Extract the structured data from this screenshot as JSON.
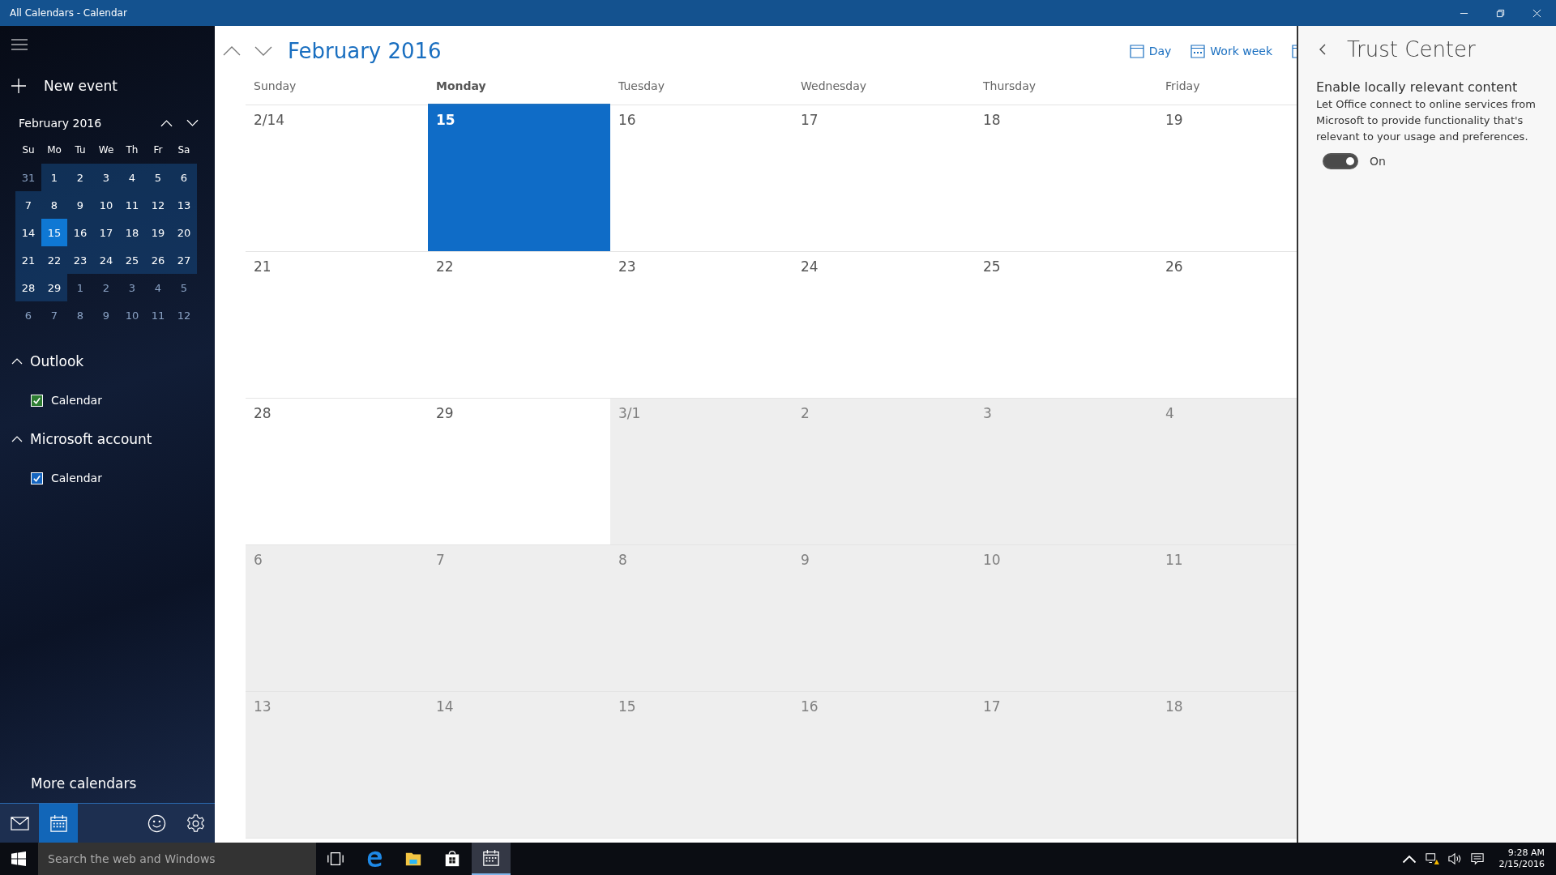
{
  "window": {
    "title": "All Calendars - Calendar"
  },
  "sidebar": {
    "new_event": "New event",
    "mini_calendar": {
      "title": "February 2016",
      "weekdays": [
        "Su",
        "Mo",
        "Tu",
        "We",
        "Th",
        "Fr",
        "Sa"
      ],
      "weeks": [
        [
          {
            "day": "31",
            "in_month": false,
            "today": false
          },
          {
            "day": "1",
            "in_month": true,
            "today": false
          },
          {
            "day": "2",
            "in_month": true,
            "today": false
          },
          {
            "day": "3",
            "in_month": true,
            "today": false
          },
          {
            "day": "4",
            "in_month": true,
            "today": false
          },
          {
            "day": "5",
            "in_month": true,
            "today": false
          },
          {
            "day": "6",
            "in_month": true,
            "today": false
          }
        ],
        [
          {
            "day": "7",
            "in_month": true,
            "today": false
          },
          {
            "day": "8",
            "in_month": true,
            "today": false
          },
          {
            "day": "9",
            "in_month": true,
            "today": false
          },
          {
            "day": "10",
            "in_month": true,
            "today": false
          },
          {
            "day": "11",
            "in_month": true,
            "today": false
          },
          {
            "day": "12",
            "in_month": true,
            "today": false
          },
          {
            "day": "13",
            "in_month": true,
            "today": false
          }
        ],
        [
          {
            "day": "14",
            "in_month": true,
            "today": false
          },
          {
            "day": "15",
            "in_month": true,
            "today": true
          },
          {
            "day": "16",
            "in_month": true,
            "today": false
          },
          {
            "day": "17",
            "in_month": true,
            "today": false
          },
          {
            "day": "18",
            "in_month": true,
            "today": false
          },
          {
            "day": "19",
            "in_month": true,
            "today": false
          },
          {
            "day": "20",
            "in_month": true,
            "today": false
          }
        ],
        [
          {
            "day": "21",
            "in_month": true,
            "today": false
          },
          {
            "day": "22",
            "in_month": true,
            "today": false
          },
          {
            "day": "23",
            "in_month": true,
            "today": false
          },
          {
            "day": "24",
            "in_month": true,
            "today": false
          },
          {
            "day": "25",
            "in_month": true,
            "today": false
          },
          {
            "day": "26",
            "in_month": true,
            "today": false
          },
          {
            "day": "27",
            "in_month": true,
            "today": false
          }
        ],
        [
          {
            "day": "28",
            "in_month": true,
            "today": false
          },
          {
            "day": "29",
            "in_month": true,
            "today": false
          },
          {
            "day": "1",
            "in_month": false,
            "today": false
          },
          {
            "day": "2",
            "in_month": false,
            "today": false
          },
          {
            "day": "3",
            "in_month": false,
            "today": false
          },
          {
            "day": "4",
            "in_month": false,
            "today": false
          },
          {
            "day": "5",
            "in_month": false,
            "today": false
          }
        ],
        [
          {
            "day": "6",
            "in_month": false,
            "today": false
          },
          {
            "day": "7",
            "in_month": false,
            "today": false
          },
          {
            "day": "8",
            "in_month": false,
            "today": false
          },
          {
            "day": "9",
            "in_month": false,
            "today": false
          },
          {
            "day": "10",
            "in_month": false,
            "today": false
          },
          {
            "day": "11",
            "in_month": false,
            "today": false
          },
          {
            "day": "12",
            "in_month": false,
            "today": false
          }
        ]
      ]
    },
    "groups": [
      {
        "name": "Outlook",
        "expanded": true,
        "calendars": [
          {
            "name": "Calendar",
            "checked": true,
            "color": "#2e7d32"
          }
        ]
      },
      {
        "name": "Microsoft account",
        "expanded": true,
        "calendars": [
          {
            "name": "Calendar",
            "checked": true,
            "color": "#1565c0"
          }
        ]
      }
    ],
    "more_calendars": "More calendars",
    "nav": [
      {
        "kind": "mail",
        "selected": false
      },
      {
        "kind": "calendar",
        "selected": true
      },
      {
        "kind": "feedback",
        "selected": false
      },
      {
        "kind": "settings",
        "selected": false
      }
    ]
  },
  "header": {
    "title": "February 2016",
    "views": [
      {
        "label": "Day",
        "kind": "day"
      },
      {
        "label": "Work week",
        "kind": "workweek"
      }
    ]
  },
  "month": {
    "weekdays": [
      {
        "label": "Sunday",
        "selected": false
      },
      {
        "label": "Monday",
        "selected": true
      },
      {
        "label": "Tuesday",
        "selected": false
      },
      {
        "label": "Wednesday",
        "selected": false
      },
      {
        "label": "Thursday",
        "selected": false
      },
      {
        "label": "Friday",
        "selected": false
      }
    ],
    "weeks": [
      [
        {
          "date": "2/14",
          "in_month": true,
          "today": false
        },
        {
          "date": "15",
          "in_month": true,
          "today": true
        },
        {
          "date": "16",
          "in_month": true,
          "today": false
        },
        {
          "date": "17",
          "in_month": true,
          "today": false
        },
        {
          "date": "18",
          "in_month": true,
          "today": false
        },
        {
          "date": "19",
          "in_month": true,
          "today": false
        }
      ],
      [
        {
          "date": "21",
          "in_month": true,
          "today": false
        },
        {
          "date": "22",
          "in_month": true,
          "today": false
        },
        {
          "date": "23",
          "in_month": true,
          "today": false
        },
        {
          "date": "24",
          "in_month": true,
          "today": false
        },
        {
          "date": "25",
          "in_month": true,
          "today": false
        },
        {
          "date": "26",
          "in_month": true,
          "today": false
        }
      ],
      [
        {
          "date": "28",
          "in_month": true,
          "today": false
        },
        {
          "date": "29",
          "in_month": true,
          "today": false
        },
        {
          "date": "3/1",
          "in_month": false,
          "today": false
        },
        {
          "date": "2",
          "in_month": false,
          "today": false
        },
        {
          "date": "3",
          "in_month": false,
          "today": false
        },
        {
          "date": "4",
          "in_month": false,
          "today": false
        }
      ],
      [
        {
          "date": "6",
          "in_month": false,
          "today": false
        },
        {
          "date": "7",
          "in_month": false,
          "today": false
        },
        {
          "date": "8",
          "in_month": false,
          "today": false
        },
        {
          "date": "9",
          "in_month": false,
          "today": false
        },
        {
          "date": "10",
          "in_month": false,
          "today": false
        },
        {
          "date": "11",
          "in_month": false,
          "today": false
        }
      ],
      [
        {
          "date": "13",
          "in_month": false,
          "today": false
        },
        {
          "date": "14",
          "in_month": false,
          "today": false
        },
        {
          "date": "15",
          "in_month": false,
          "today": false
        },
        {
          "date": "16",
          "in_month": false,
          "today": false
        },
        {
          "date": "17",
          "in_month": false,
          "today": false
        },
        {
          "date": "18",
          "in_month": false,
          "today": false
        }
      ]
    ]
  },
  "trust_center": {
    "title": "Trust Center",
    "heading": "Enable locally relevant content",
    "description": "Let Office connect to online services from Microsoft to provide functionality that's relevant to your usage and preferences.",
    "toggle": {
      "on": true,
      "label": "On"
    }
  },
  "taskbar": {
    "search_placeholder": "Search the web and Windows",
    "apps": [
      {
        "kind": "task-view",
        "active": false
      },
      {
        "kind": "browser",
        "active": false
      },
      {
        "kind": "folder",
        "active": false
      },
      {
        "kind": "store",
        "active": false
      },
      {
        "kind": "calendar",
        "active": true
      }
    ],
    "time": "9:28 AM",
    "date": "2/15/2016"
  }
}
